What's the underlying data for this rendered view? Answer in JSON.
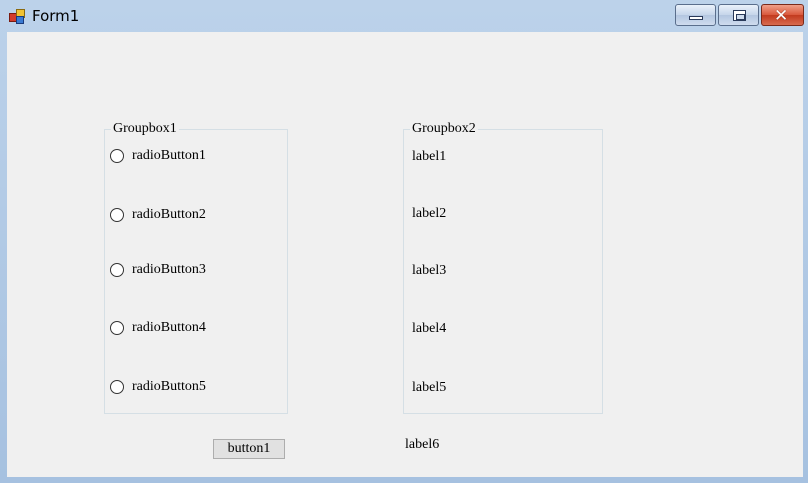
{
  "window": {
    "title": "Form1"
  },
  "groupbox1": {
    "caption": "Groupbox1",
    "radios": [
      "radioButton1",
      "radioButton2",
      "radioButton3",
      "radioButton4",
      "radioButton5"
    ]
  },
  "groupbox2": {
    "caption": "Groupbox2",
    "labels": [
      "label1",
      "label2",
      "label3",
      "label4",
      "label5"
    ]
  },
  "button1": {
    "label": "button1"
  },
  "label6": {
    "text": "label6"
  }
}
